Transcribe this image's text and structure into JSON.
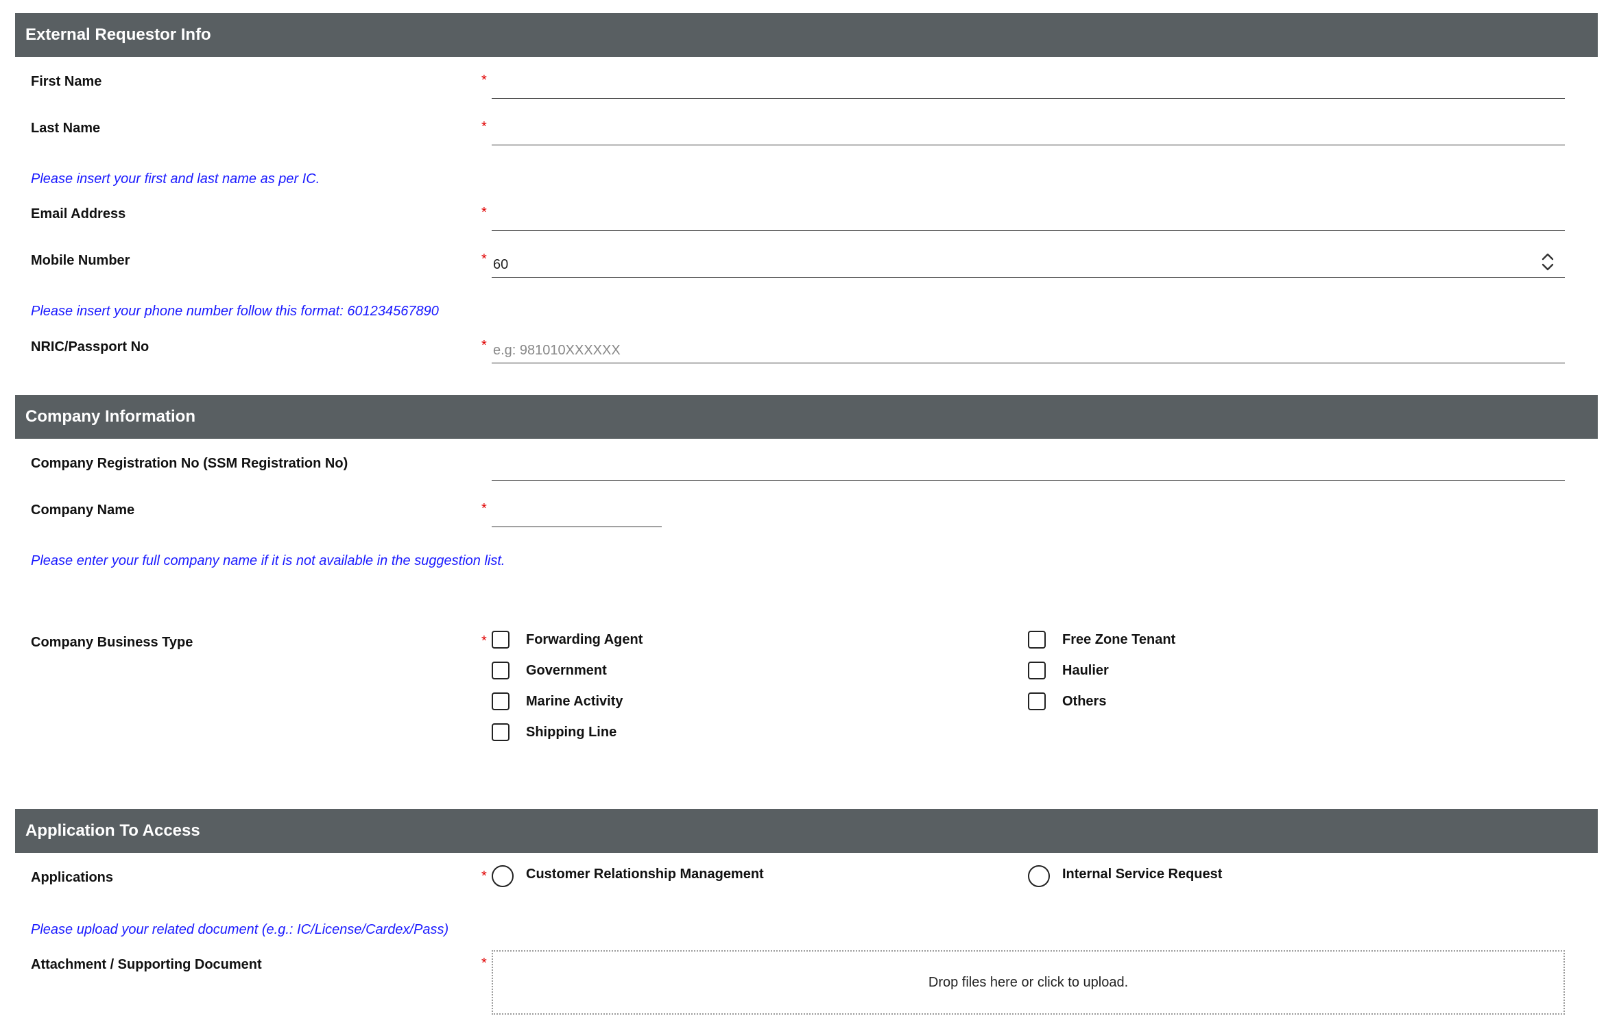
{
  "sections": {
    "external": {
      "title": "External Requestor Info"
    },
    "company": {
      "title": "Company Information"
    },
    "application": {
      "title": "Application To Access"
    }
  },
  "requestor": {
    "first_name": {
      "label": "First Name",
      "required": "*",
      "value": ""
    },
    "last_name": {
      "label": "Last Name",
      "required": "*",
      "value": ""
    },
    "name_hint": "Please insert your first and last name as per IC.",
    "email": {
      "label": "Email Address",
      "required": "*",
      "value": ""
    },
    "mobile": {
      "label": "Mobile Number",
      "required": "*",
      "value": "60"
    },
    "phone_hint": "Please insert your phone number follow this format: 601234567890",
    "nric": {
      "label": "NRIC/Passport No",
      "required": "*",
      "value": "",
      "placeholder": "e.g: 981010XXXXXX"
    }
  },
  "company": {
    "registration": {
      "label": "Company Registration No (SSM Registration No)",
      "value": ""
    },
    "name": {
      "label": "Company Name",
      "required": "*",
      "value": ""
    },
    "name_hint": "Please enter your full company name if it is not available in the suggestion list.",
    "business_type": {
      "label": "Company Business Type",
      "required": "*",
      "options": [
        {
          "label": "Forwarding Agent",
          "checked": false
        },
        {
          "label": "Government",
          "checked": false
        },
        {
          "label": "Marine Activity",
          "checked": false
        },
        {
          "label": "Shipping Line",
          "checked": false
        },
        {
          "label": "Free Zone Tenant",
          "checked": false
        },
        {
          "label": "Haulier",
          "checked": false
        },
        {
          "label": "Others",
          "checked": false
        }
      ]
    }
  },
  "application": {
    "applications": {
      "label": "Applications",
      "required": "*",
      "options": [
        {
          "label": "Customer Relationship Management",
          "selected": false
        },
        {
          "label": "Internal Service Request",
          "selected": false
        }
      ]
    },
    "upload_hint": "Please upload your related document (e.g.: IC/License/Cardex/Pass)",
    "attachment": {
      "label": "Attachment / Supporting Document",
      "required": "*",
      "dropzone_text": "Drop files here or click to upload."
    }
  },
  "colors": {
    "header_bg": "#595f62",
    "required_star": "#e00000",
    "hint_text": "#1a1aff"
  },
  "icons": [
    "chevron-up-icon",
    "chevron-down-icon"
  ]
}
